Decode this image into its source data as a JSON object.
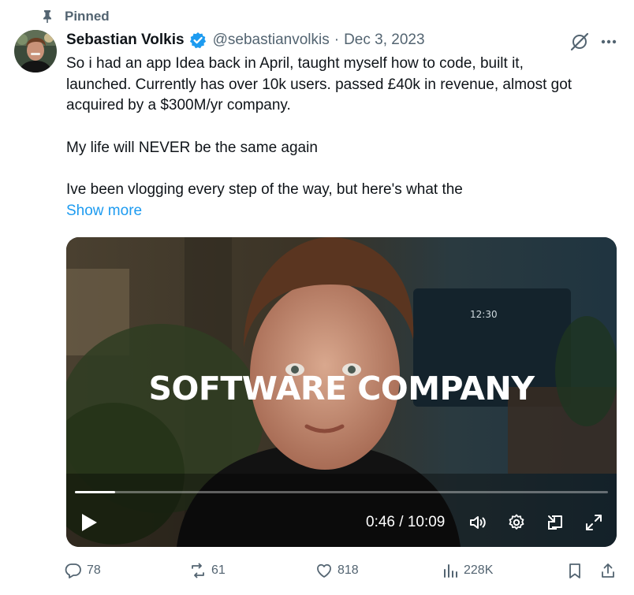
{
  "pinned": {
    "label": "Pinned",
    "icon": "pin-icon"
  },
  "author": {
    "name": "Sebastian Volkis",
    "handle": "@sebastianvolkis",
    "separator": "·",
    "date": "Dec 3, 2023",
    "verified_icon": "verified-badge-icon",
    "verified_color": "#1d9bf0"
  },
  "tweet": {
    "line1": "So i had an app Idea back in April, taught myself how to code, built it,",
    "line2": "launched. Currently has over 10k users. passed £40k in revenue, almost got",
    "line3": "acquired by a $300M/yr company.",
    "line4": "My life will NEVER be the same again",
    "line5": "Ive been vlogging every step of the way, but here's what the",
    "show_more": "Show more"
  },
  "video": {
    "caption": "SOFTWARE COMPANY",
    "current_time": "0:46",
    "duration": "10:09",
    "time_display": "0:46 / 10:09",
    "progress_fraction": 0.0755
  },
  "actions": {
    "replies": "78",
    "reposts": "61",
    "likes": "818",
    "views": "228K"
  },
  "colors": {
    "accent": "#1d9bf0",
    "text_primary": "#0f1419",
    "text_secondary": "#536471"
  }
}
